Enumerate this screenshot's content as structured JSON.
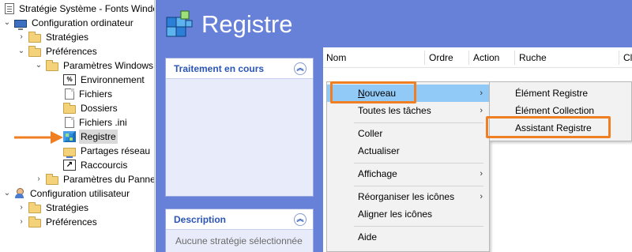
{
  "tree": {
    "window_title": "Stratégie Système - Fonts Windows",
    "nodes": [
      {
        "label": "Stratégie Système - Fonts Windows",
        "icon": "document-icon"
      },
      {
        "label": "Configuration ordinateur",
        "icon": "computer-icon",
        "expander": "⌄"
      },
      {
        "label": "Stratégies",
        "icon": "folder-icon",
        "expander": "›"
      },
      {
        "label": "Préférences",
        "icon": "folder-icon",
        "expander": "⌄"
      },
      {
        "label": "Paramètres Windows",
        "icon": "folder-icon",
        "expander": "⌄"
      },
      {
        "label": "Environnement",
        "icon": "environment-icon"
      },
      {
        "label": "Fichiers",
        "icon": "file-icon"
      },
      {
        "label": "Dossiers",
        "icon": "folder-icon"
      },
      {
        "label": "Fichiers .ini",
        "icon": "ini-file-icon"
      },
      {
        "label": "Registre",
        "icon": "registry-icon"
      },
      {
        "label": "Partages réseau",
        "icon": "network-share-icon"
      },
      {
        "label": "Raccourcis",
        "icon": "shortcut-icon"
      },
      {
        "label": "Paramètres du Panneau de configuration",
        "icon": "folder-icon",
        "expander": "›"
      },
      {
        "label": "Configuration utilisateur",
        "icon": "user-icon",
        "expander": "⌄"
      },
      {
        "label": "Stratégies",
        "icon": "folder-icon",
        "expander": "›"
      },
      {
        "label": "Préférences",
        "icon": "folder-icon",
        "expander": "›"
      }
    ]
  },
  "main": {
    "title": "Registre",
    "processing_panel": {
      "title": "Traitement en cours"
    },
    "description_panel": {
      "title": "Description",
      "text": "Aucune stratégie sélectionnée"
    },
    "columns": [
      "Nom",
      "Ordre",
      "Action",
      "Ruche",
      "Clé"
    ]
  },
  "context_menu": {
    "items": [
      {
        "label": "Nouveau",
        "has_submenu": true,
        "highlighted": true
      },
      {
        "label": "Toutes les tâches",
        "has_submenu": true
      },
      {
        "label": "Coller"
      },
      {
        "label": "Actualiser"
      },
      {
        "label": "Affichage",
        "has_submenu": true
      },
      {
        "label": "Réorganiser les icônes",
        "has_submenu": true
      },
      {
        "label": "Aligner les icônes"
      },
      {
        "label": "Aide"
      }
    ]
  },
  "submenu": {
    "items": [
      {
        "label": "Élément Registre"
      },
      {
        "label": "Élément Collection"
      },
      {
        "label": "Assistant Registre",
        "highlighted_frame": true
      }
    ]
  },
  "colors": {
    "panel_blue": "#6781d8",
    "highlight_orange": "#f07f23",
    "menu_highlight": "#91c9f7"
  }
}
